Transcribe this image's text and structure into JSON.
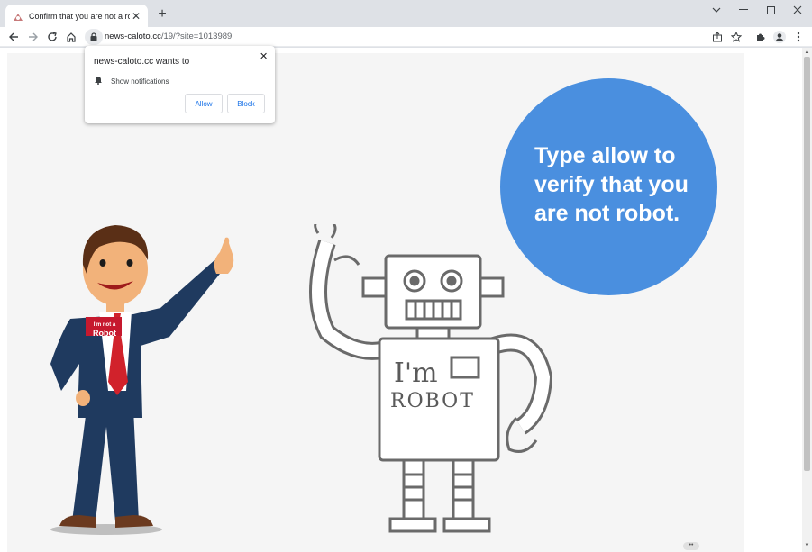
{
  "browser": {
    "tab": {
      "title": "Confirm that you are not a robot",
      "close_glyph": "✕"
    },
    "new_tab_glyph": "+",
    "url": {
      "host": "news-caloto.cc",
      "path": "/19/?site=1013989"
    },
    "icons": {
      "back": "back-arrow-icon",
      "forward": "forward-arrow-icon",
      "reload": "reload-icon",
      "home": "home-icon",
      "lock": "lock-icon",
      "share": "share-icon",
      "star": "bookmark-star-icon",
      "extensions": "puzzle-icon",
      "profile": "profile-icon",
      "menu": "kebab-menu-icon"
    }
  },
  "popup": {
    "title": "news-caloto.cc wants to",
    "permission": "Show notifications",
    "allow_label": "Allow",
    "block_label": "Block",
    "close_glyph": "✕"
  },
  "page": {
    "bubble_text": "Type allow to verify that you are not robot.",
    "badge_line1": "I'm not a",
    "badge_line2": "Robot",
    "robot_line1": "I'm",
    "robot_line2": "ROBOT",
    "bubble_color": "#4a8fdf"
  }
}
